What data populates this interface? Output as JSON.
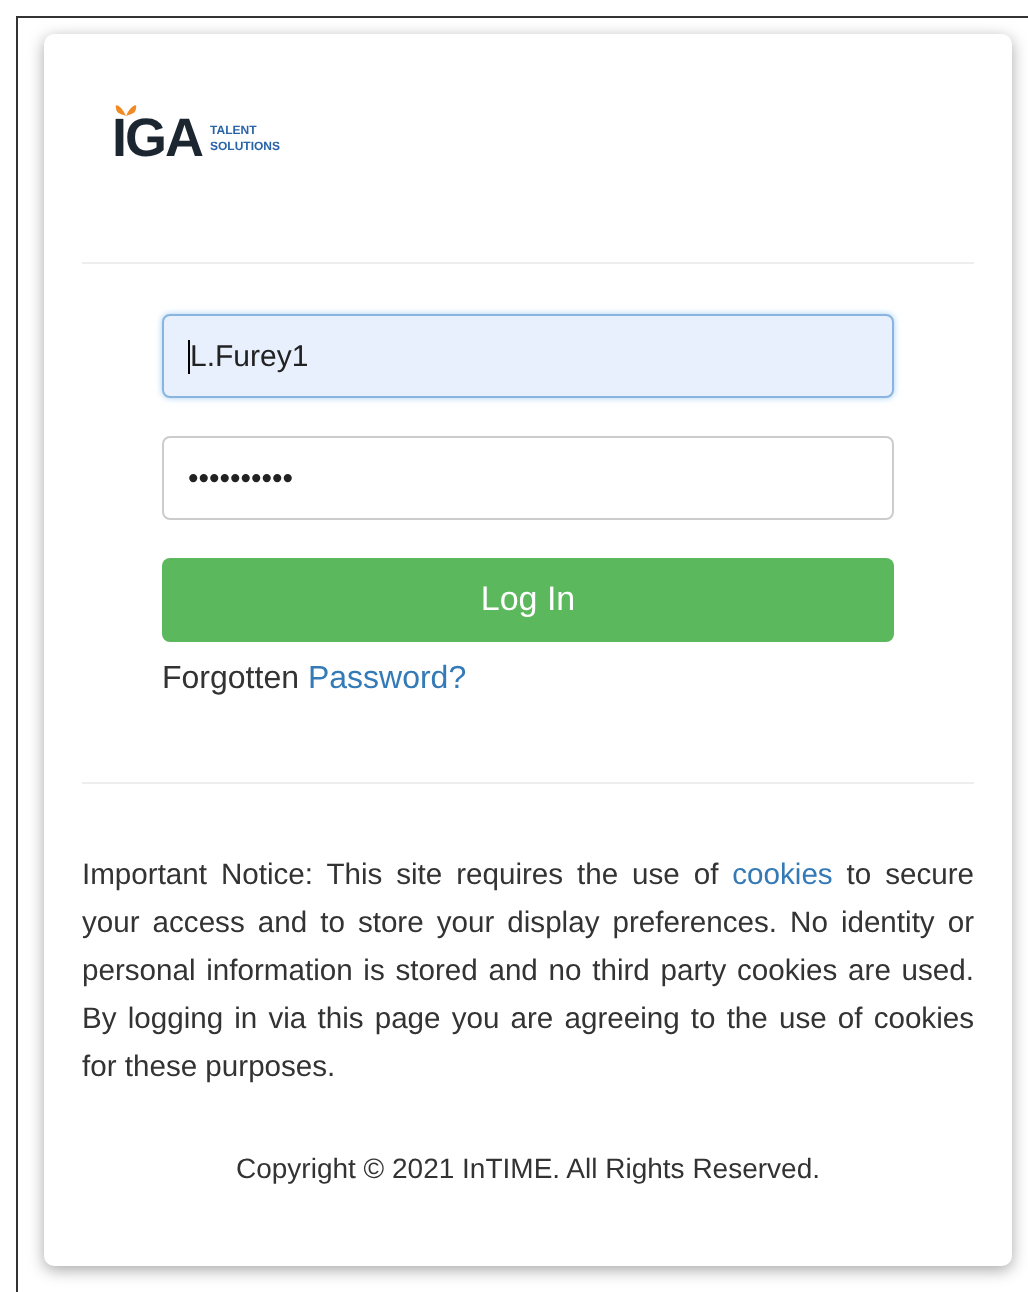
{
  "logo": {
    "name": "IGA",
    "tagline": "TALENT SOLUTIONS"
  },
  "login": {
    "username": {
      "value": "L.Furey1",
      "focused": true
    },
    "password": {
      "value": "••••••••••",
      "focused": false
    },
    "button": "Log In",
    "forgot": {
      "text": "Forgotten",
      "link": "Password?"
    }
  },
  "notice": {
    "before": "Important Notice: This site requires the use of",
    "link": "cookies",
    "after": "to secure your access and to store your display preferences. No identity or personal information is stored and no third party cookies are used. By logging in via this page you are agreeing to the use of cookies for these purposes."
  },
  "copyright": "Copyright © 2021 InTIME. All Rights Reserved."
}
